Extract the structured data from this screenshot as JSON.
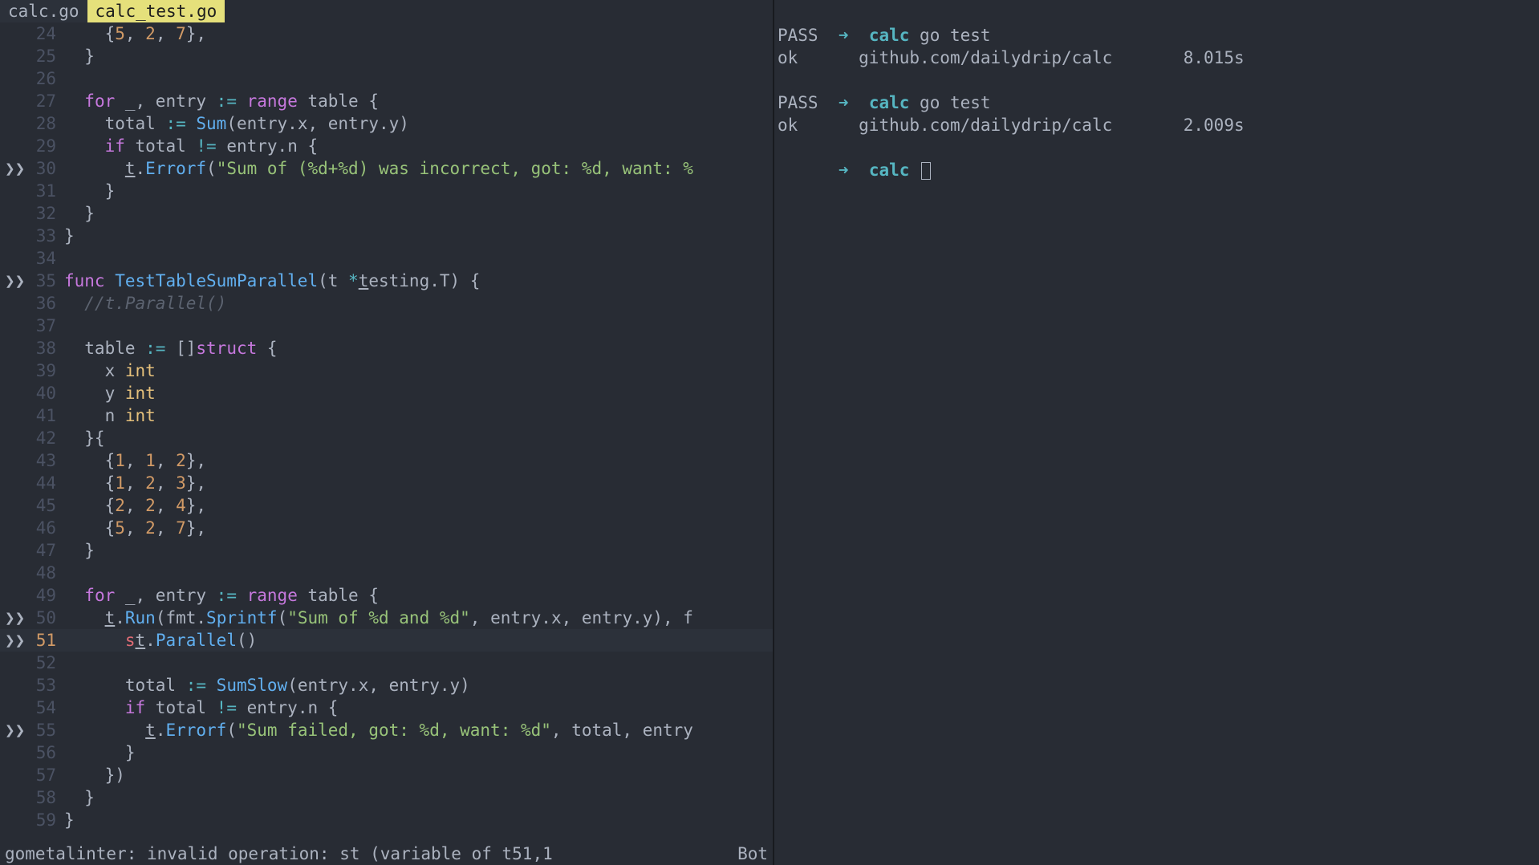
{
  "tabs": {
    "inactive": "calc.go",
    "active": "calc_test.go"
  },
  "editor": {
    "current_line": 51,
    "sign_marker": "❯❯",
    "lines": [
      {
        "n": 24,
        "sign": "",
        "tokens": [
          [
            "pl",
            "    {"
          ],
          [
            "num",
            "5"
          ],
          [
            "pl",
            ", "
          ],
          [
            "num",
            "2"
          ],
          [
            "pl",
            ", "
          ],
          [
            "num",
            "7"
          ],
          [
            "pl",
            "},"
          ]
        ]
      },
      {
        "n": 25,
        "sign": "",
        "tokens": [
          [
            "pl",
            "  }"
          ]
        ]
      },
      {
        "n": 26,
        "sign": "",
        "tokens": []
      },
      {
        "n": 27,
        "sign": "",
        "tokens": [
          [
            "pl",
            "  "
          ],
          [
            "kw",
            "for"
          ],
          [
            "pl",
            " _, entry "
          ],
          [
            "op",
            ":="
          ],
          [
            "pl",
            " "
          ],
          [
            "kw",
            "range"
          ],
          [
            "pl",
            " table {"
          ]
        ]
      },
      {
        "n": 28,
        "sign": "",
        "tokens": [
          [
            "pl",
            "    total "
          ],
          [
            "op",
            ":="
          ],
          [
            "pl",
            " "
          ],
          [
            "call",
            "Sum"
          ],
          [
            "pl",
            "(entry.x, entry.y)"
          ]
        ]
      },
      {
        "n": 29,
        "sign": "",
        "tokens": [
          [
            "pl",
            "    "
          ],
          [
            "kw",
            "if"
          ],
          [
            "pl",
            " total "
          ],
          [
            "op",
            "!="
          ],
          [
            "pl",
            " entry.n {"
          ]
        ]
      },
      {
        "n": 30,
        "sign": "m",
        "tokens": [
          [
            "pl",
            "      "
          ],
          [
            "und",
            "t"
          ],
          [
            "pl",
            "."
          ],
          [
            "call",
            "Errorf"
          ],
          [
            "pl",
            "("
          ],
          [
            "str",
            "\"Sum of (%d+%d) was incorrect, got: %d, want: %"
          ]
        ]
      },
      {
        "n": 31,
        "sign": "",
        "tokens": [
          [
            "pl",
            "    }"
          ]
        ]
      },
      {
        "n": 32,
        "sign": "",
        "tokens": [
          [
            "pl",
            "  }"
          ]
        ]
      },
      {
        "n": 33,
        "sign": "",
        "tokens": [
          [
            "pl",
            "}"
          ]
        ]
      },
      {
        "n": 34,
        "sign": "",
        "tokens": []
      },
      {
        "n": 35,
        "sign": "m",
        "tokens": [
          [
            "kw",
            "func"
          ],
          [
            "pl",
            " "
          ],
          [
            "fn",
            "TestTableSumParallel"
          ],
          [
            "pl",
            "(t "
          ],
          [
            "op",
            "*"
          ],
          [
            "und",
            "t"
          ],
          [
            "pl",
            "esting.T) {"
          ]
        ]
      },
      {
        "n": 36,
        "sign": "",
        "tokens": [
          [
            "pl",
            "  "
          ],
          [
            "cm",
            "//t.Parallel()"
          ]
        ]
      },
      {
        "n": 37,
        "sign": "",
        "tokens": []
      },
      {
        "n": 38,
        "sign": "",
        "tokens": [
          [
            "pl",
            "  table "
          ],
          [
            "op",
            ":="
          ],
          [
            "pl",
            " []"
          ],
          [
            "kw",
            "struct"
          ],
          [
            "pl",
            " {"
          ]
        ]
      },
      {
        "n": 39,
        "sign": "",
        "tokens": [
          [
            "pl",
            "    x "
          ],
          [
            "typ",
            "int"
          ]
        ]
      },
      {
        "n": 40,
        "sign": "",
        "tokens": [
          [
            "pl",
            "    y "
          ],
          [
            "typ",
            "int"
          ]
        ]
      },
      {
        "n": 41,
        "sign": "",
        "tokens": [
          [
            "pl",
            "    n "
          ],
          [
            "typ",
            "int"
          ]
        ]
      },
      {
        "n": 42,
        "sign": "",
        "tokens": [
          [
            "pl",
            "  }{"
          ]
        ]
      },
      {
        "n": 43,
        "sign": "",
        "tokens": [
          [
            "pl",
            "    {"
          ],
          [
            "num",
            "1"
          ],
          [
            "pl",
            ", "
          ],
          [
            "num",
            "1"
          ],
          [
            "pl",
            ", "
          ],
          [
            "num",
            "2"
          ],
          [
            "pl",
            "},"
          ]
        ]
      },
      {
        "n": 44,
        "sign": "",
        "tokens": [
          [
            "pl",
            "    {"
          ],
          [
            "num",
            "1"
          ],
          [
            "pl",
            ", "
          ],
          [
            "num",
            "2"
          ],
          [
            "pl",
            ", "
          ],
          [
            "num",
            "3"
          ],
          [
            "pl",
            "},"
          ]
        ]
      },
      {
        "n": 45,
        "sign": "",
        "tokens": [
          [
            "pl",
            "    {"
          ],
          [
            "num",
            "2"
          ],
          [
            "pl",
            ", "
          ],
          [
            "num",
            "2"
          ],
          [
            "pl",
            ", "
          ],
          [
            "num",
            "4"
          ],
          [
            "pl",
            "},"
          ]
        ]
      },
      {
        "n": 46,
        "sign": "",
        "tokens": [
          [
            "pl",
            "    {"
          ],
          [
            "num",
            "5"
          ],
          [
            "pl",
            ", "
          ],
          [
            "num",
            "2"
          ],
          [
            "pl",
            ", "
          ],
          [
            "num",
            "7"
          ],
          [
            "pl",
            "},"
          ]
        ]
      },
      {
        "n": 47,
        "sign": "",
        "tokens": [
          [
            "pl",
            "  }"
          ]
        ]
      },
      {
        "n": 48,
        "sign": "",
        "tokens": []
      },
      {
        "n": 49,
        "sign": "",
        "tokens": [
          [
            "pl",
            "  "
          ],
          [
            "kw",
            "for"
          ],
          [
            "pl",
            " _, entry "
          ],
          [
            "op",
            ":="
          ],
          [
            "pl",
            " "
          ],
          [
            "kw",
            "range"
          ],
          [
            "pl",
            " table {"
          ]
        ]
      },
      {
        "n": 50,
        "sign": "m",
        "tokens": [
          [
            "pl",
            "    "
          ],
          [
            "und",
            "t"
          ],
          [
            "pl",
            "."
          ],
          [
            "call",
            "Run"
          ],
          [
            "pl",
            "(fmt."
          ],
          [
            "call",
            "Sprintf"
          ],
          [
            "pl",
            "("
          ],
          [
            "str",
            "\"Sum of %d and %d\""
          ],
          [
            "pl",
            ", entry.x, entry.y), f"
          ]
        ]
      },
      {
        "n": 51,
        "sign": "m",
        "cur": true,
        "tokens": [
          [
            "pl",
            "      "
          ],
          [
            "red",
            "s"
          ],
          [
            "und",
            "t"
          ],
          [
            "pl",
            "."
          ],
          [
            "call",
            "Parallel"
          ],
          [
            "pl",
            "()"
          ]
        ]
      },
      {
        "n": 52,
        "sign": "",
        "tokens": []
      },
      {
        "n": 53,
        "sign": "",
        "tokens": [
          [
            "pl",
            "      total "
          ],
          [
            "op",
            ":="
          ],
          [
            "pl",
            " "
          ],
          [
            "call",
            "SumSlow"
          ],
          [
            "pl",
            "(entry.x, entry.y)"
          ]
        ]
      },
      {
        "n": 54,
        "sign": "",
        "tokens": [
          [
            "pl",
            "      "
          ],
          [
            "kw",
            "if"
          ],
          [
            "pl",
            " total "
          ],
          [
            "op",
            "!="
          ],
          [
            "pl",
            " entry.n {"
          ]
        ]
      },
      {
        "n": 55,
        "sign": "m",
        "tokens": [
          [
            "pl",
            "        "
          ],
          [
            "und",
            "t"
          ],
          [
            "pl",
            "."
          ],
          [
            "call",
            "Errorf"
          ],
          [
            "pl",
            "("
          ],
          [
            "str",
            "\"Sum failed, got: %d, want: %d\""
          ],
          [
            "pl",
            ", total, entry"
          ]
        ]
      },
      {
        "n": 56,
        "sign": "",
        "tokens": [
          [
            "pl",
            "      }"
          ]
        ]
      },
      {
        "n": 57,
        "sign": "",
        "tokens": [
          [
            "pl",
            "    })"
          ]
        ]
      },
      {
        "n": 58,
        "sign": "",
        "tokens": [
          [
            "pl",
            "  }"
          ]
        ]
      },
      {
        "n": 59,
        "sign": "",
        "tokens": [
          [
            "pl",
            "}"
          ]
        ]
      }
    ]
  },
  "status": {
    "left": "gometalinter: invalid operation: st (variable of t51,1",
    "right": "Bot"
  },
  "terminal": {
    "arrow": "➜",
    "dir": "calc",
    "cmd": "go test",
    "pass": "PASS",
    "ok": "ok",
    "pkg": "github.com/dailydrip/calc",
    "t1": "8.015s",
    "t2": "2.009s"
  }
}
